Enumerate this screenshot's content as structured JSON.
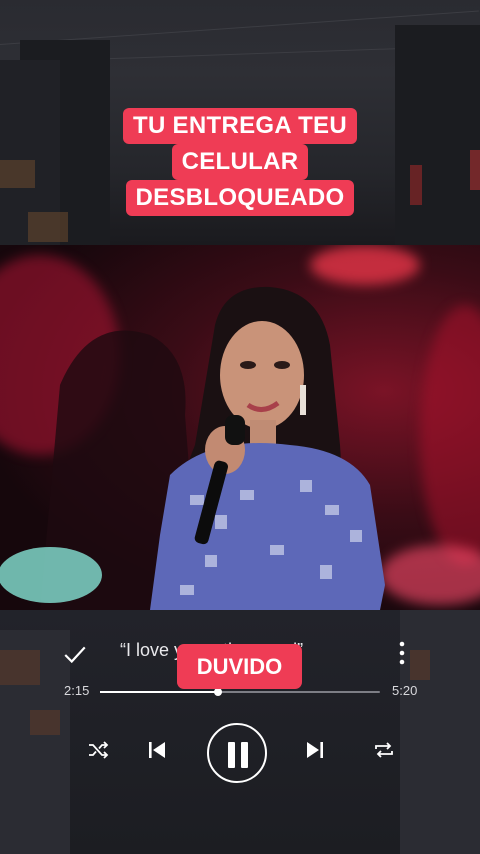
{
  "caption": {
    "lines": [
      "TU ENTREGA TEU",
      "CELULAR",
      "DESBLOQUEADO"
    ],
    "color": "#ef3c55"
  },
  "overlay": {
    "text": "DUVIDO",
    "color": "#ef3c55"
  },
  "player": {
    "lyric": "“I love you a thousand”",
    "elapsed": "2:15",
    "duration": "5:20",
    "progress": 0.42,
    "icons": {
      "check": "check-icon",
      "more": "more-vertical-icon",
      "shuffle": "shuffle-icon",
      "previous": "skip-previous-icon",
      "pause": "pause-icon",
      "next": "skip-next-icon",
      "repeat": "repeat-icon"
    }
  },
  "video": {
    "description_icon": "concert-video"
  }
}
